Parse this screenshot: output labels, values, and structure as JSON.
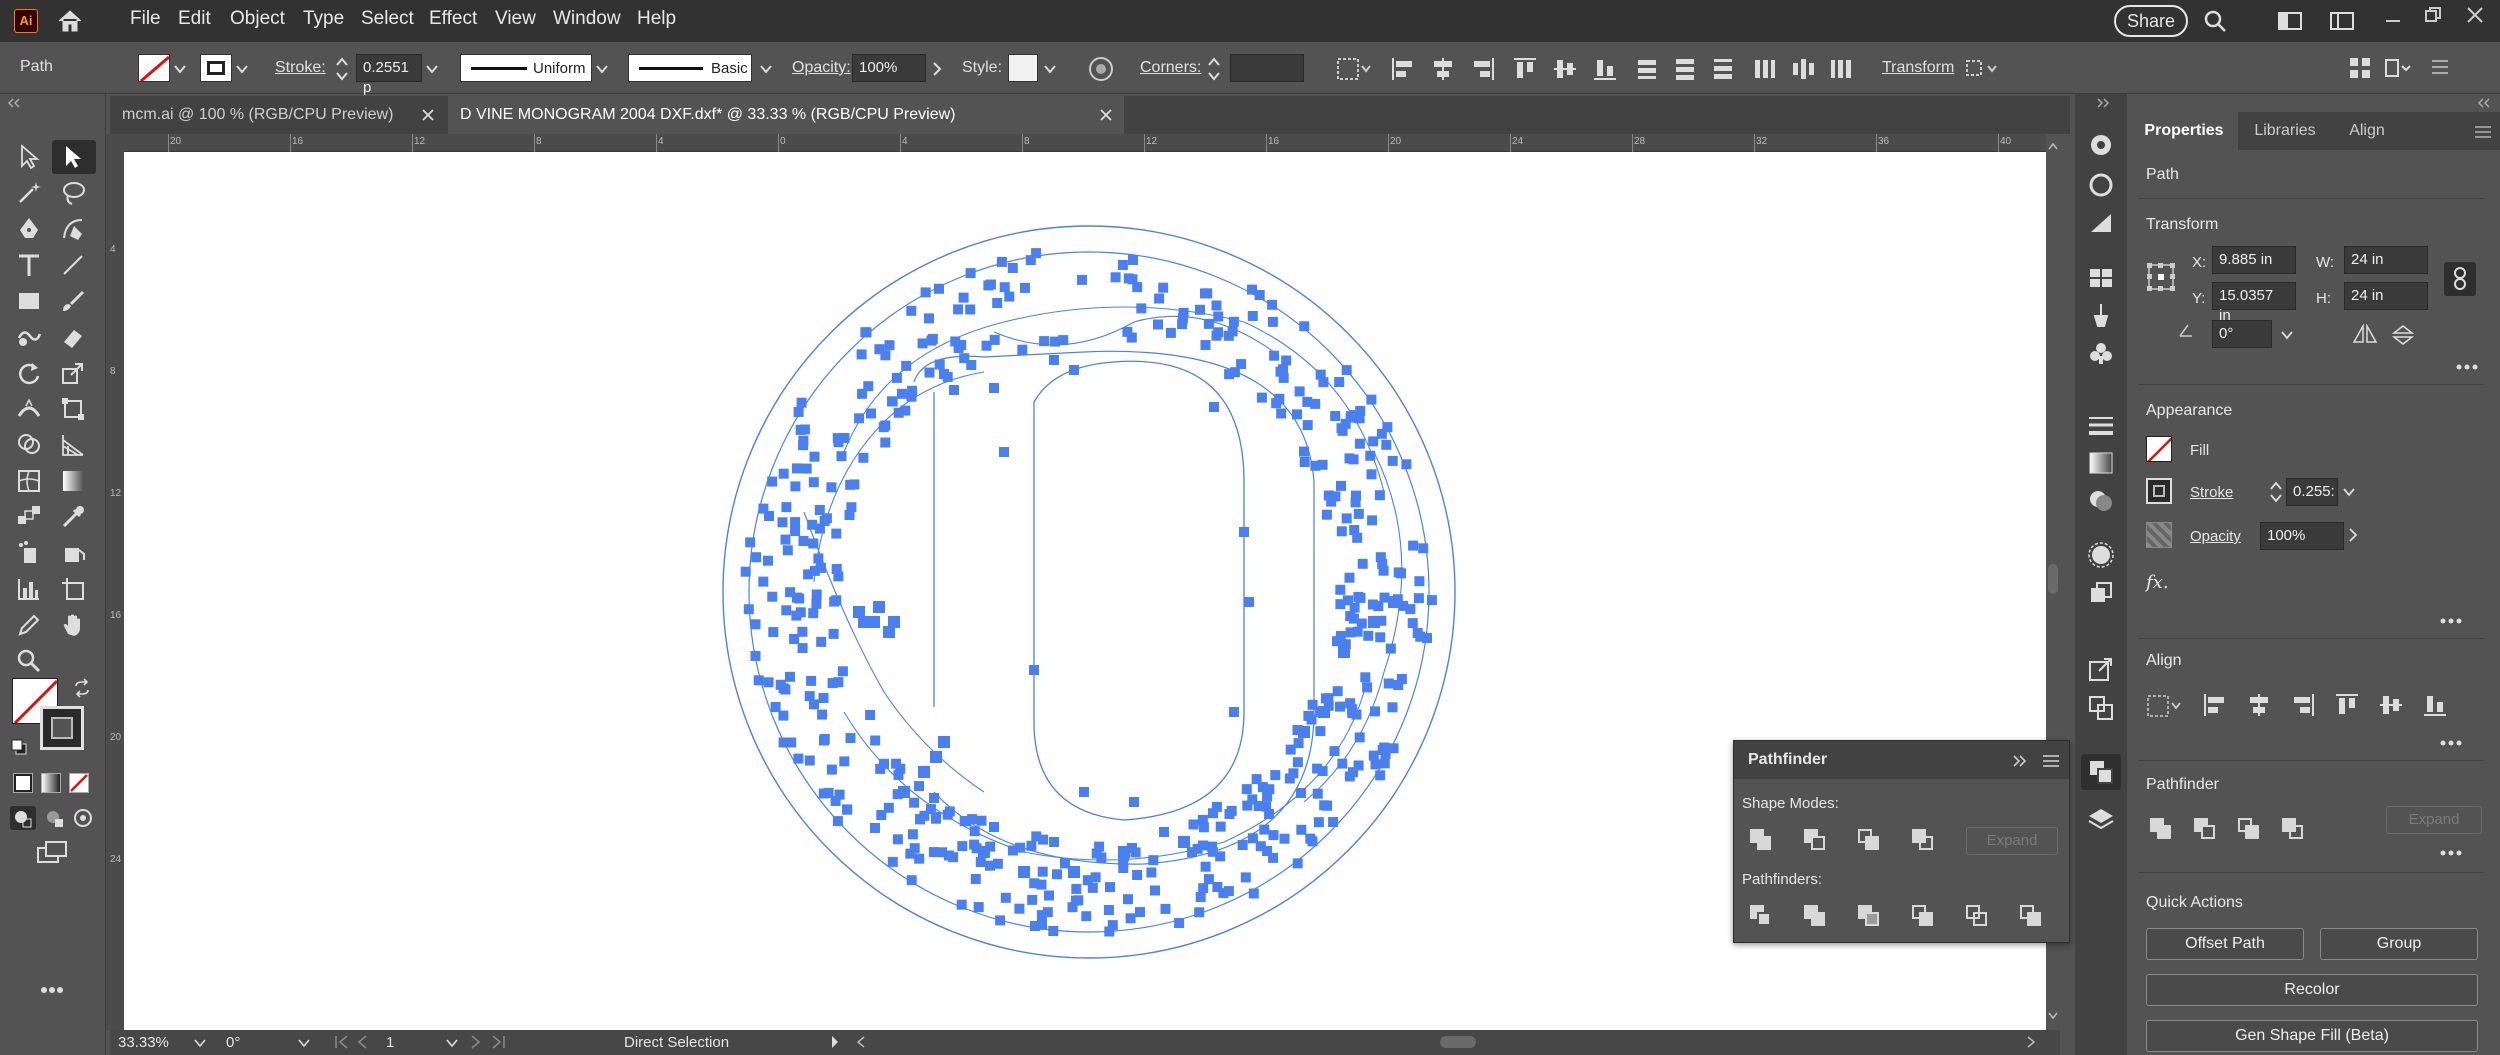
{
  "app": {
    "logo": "Ai",
    "share": "Share"
  },
  "menu": [
    "File",
    "Edit",
    "Object",
    "Type",
    "Select",
    "Effect",
    "View",
    "Window",
    "Help"
  ],
  "control": {
    "object_type": "Path",
    "stroke_label": "Stroke:",
    "stroke_value": "0.2551 p",
    "profile": "Uniform",
    "brush": "Basic",
    "opacity_label": "Opacity:",
    "opacity_value": "100%",
    "style_label": "Style:",
    "corners_label": "Corners:",
    "transform_label": "Transform"
  },
  "tabs": [
    {
      "label": "mcm.ai @ 100 % (RGB/CPU Preview)",
      "active": false
    },
    {
      "label": "D VINE MONOGRAM 2004 DXF.dxf* @ 33.33 % (RGB/CPU Preview)",
      "active": true
    }
  ],
  "ruler": {
    "h_ticks": [
      "20",
      "16",
      "12",
      "8",
      "4",
      "0",
      "4",
      "8",
      "12",
      "16",
      "20",
      "24",
      "28",
      "32",
      "36",
      "40"
    ],
    "v_ticks": [
      "4",
      "8",
      "12",
      "16",
      "20",
      "24"
    ]
  },
  "status": {
    "zoom": "33.33%",
    "rotation": "0°",
    "artboard": "1",
    "tool": "Direct Selection"
  },
  "properties": {
    "tabs": [
      "Properties",
      "Libraries",
      "Align"
    ],
    "kind": "Path",
    "transform": {
      "title": "Transform",
      "x_label": "X:",
      "x": "9.885 in",
      "y_label": "Y:",
      "y": "15.0357 in",
      "w_label": "W:",
      "w": "24 in",
      "h_label": "H:",
      "h": "24 in",
      "angle": "0°"
    },
    "appearance": {
      "title": "Appearance",
      "fill": "Fill",
      "stroke": "Stroke",
      "stroke_value": "0.255:",
      "opacity": "Opacity",
      "opacity_value": "100%",
      "fx": "fx."
    },
    "align": {
      "title": "Align"
    },
    "pathfinder": {
      "title": "Pathfinder",
      "expand": "Expand"
    },
    "quick_actions": {
      "title": "Quick Actions",
      "offset_path": "Offset Path",
      "group": "Group",
      "recolor": "Recolor",
      "gen_shape": "Gen Shape Fill (Beta)"
    }
  },
  "pathfinder_panel": {
    "title": "Pathfinder",
    "shape_modes": "Shape Modes:",
    "expand": "Expand",
    "pathfinders": "Pathfinders:"
  },
  "colors": {
    "accent": "#4a7ff0",
    "menubar": "#323232",
    "panel": "#535353"
  }
}
